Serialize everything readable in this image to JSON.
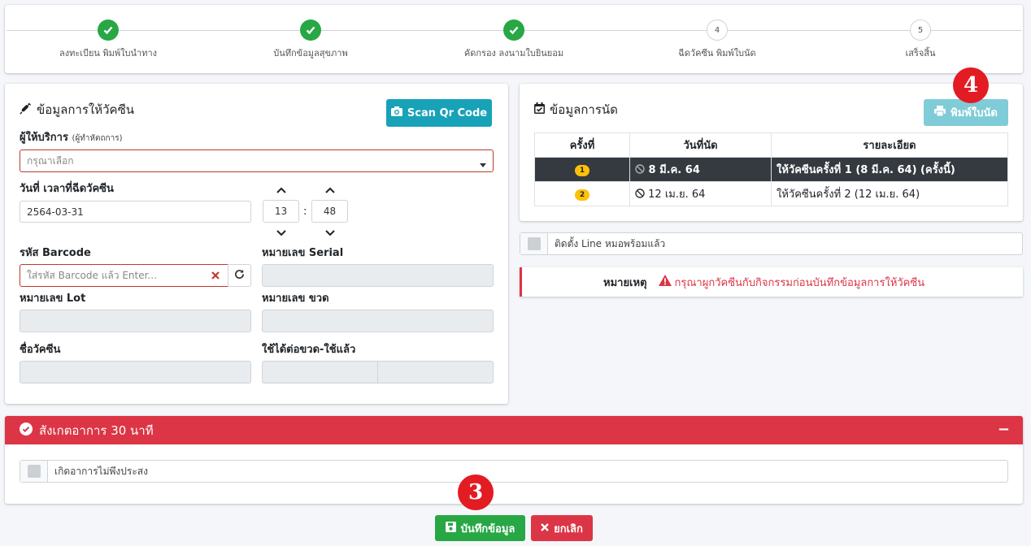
{
  "stepper": {
    "steps": [
      {
        "label": "ลงทะเบียน พิมพ์ใบนำทาง",
        "status": "done"
      },
      {
        "label": "บันทึกข้อมูลสุขภาพ",
        "status": "done"
      },
      {
        "label": "คัดกรอง ลงนามใบยินยอม",
        "status": "done"
      },
      {
        "label": "ฉีดวัคซีน พิมพ์ใบนัด",
        "number": "4",
        "status": "pending"
      },
      {
        "label": "เสร็จสิ้น",
        "number": "5",
        "status": "pending"
      }
    ]
  },
  "vaccine_form": {
    "title": "ข้อมูลการให้วัคซีน",
    "scan_button": "Scan Qr Code",
    "provider_label": "ผู้ให้บริการ",
    "provider_hint": "(ผู้ทำหัตถการ)",
    "provider_placeholder": "กรุณาเลือก",
    "datetime_label": "วันที่ เวลาที่ฉีดวัคซีน",
    "date_value": "2564-03-31",
    "hour": "13",
    "minute": "48",
    "time_sep": ":",
    "barcode_label": "รหัส Barcode",
    "barcode_placeholder": "ใส่รหัส Barcode แล้ว Enter...",
    "serial_label": "หมายเลข Serial",
    "lot_label": "หมายเลข Lot",
    "bottle_label": "หมายเลข ขวด",
    "vaccine_name_label": "ชื่อวัคซีน",
    "usage_label": "ใช้ได้ต่อขวด-ใช้แล้ว"
  },
  "appointment": {
    "title": "ข้อมูลการนัด",
    "print_button": "พิมพ์ใบนัด",
    "columns": [
      "ครั้งที่",
      "วันที่นัด",
      "รายละเอียด"
    ],
    "rows": [
      {
        "no": "1",
        "date": "8 มี.ค. 64",
        "detail": "ให้วัคซีนครั้งที่ 1 (8 มี.ค. 64) (ครั้งนี้)",
        "selected": true
      },
      {
        "no": "2",
        "date": "12 เม.ย. 64",
        "detail": "ให้วัคซีนครั้งที่ 2 (12 เม.ย. 64)",
        "selected": false
      }
    ]
  },
  "line_option": "ติดตั้ง Line หมอพร้อมแล้ว",
  "remark": {
    "label": "หมายเหตุ",
    "message": "กรุณาผูกวัคซีนกับกิจกรรมก่อนบันทึกข้อมูลการให้วัคซีน"
  },
  "observe": {
    "title": "สังเกตอาการ 30 นาที",
    "collapse_symbol": "−",
    "side_effect_option": "เกิดอาการไม่พึงประสง"
  },
  "actions": {
    "save": "บันทึกข้อมูล",
    "cancel": "ยกเลิก"
  },
  "markers": {
    "save": "3",
    "print": "4"
  },
  "colors": {
    "success": "#28a745",
    "info": "#17a2b8",
    "danger": "#dc3545",
    "warning": "#ffc107",
    "marker": "#e31b23"
  }
}
